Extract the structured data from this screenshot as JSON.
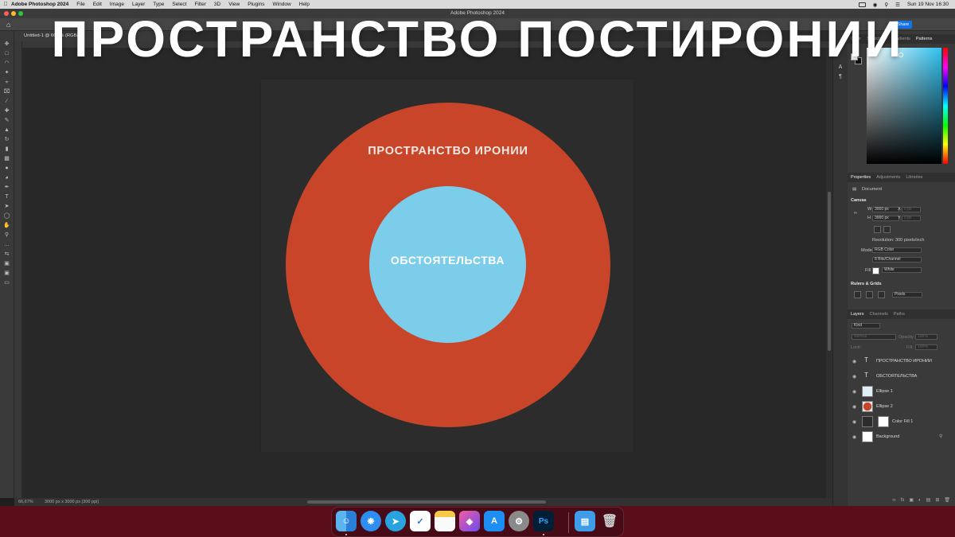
{
  "overlay_title": "ПРОСТРАНСТВО ПОСТИРОНИИ",
  "menubar": {
    "app_name": "Adobe Photoshop 2024",
    "items": [
      "File",
      "Edit",
      "Image",
      "Layer",
      "Type",
      "Select",
      "Filter",
      "3D",
      "View",
      "Plugins",
      "Window",
      "Help"
    ],
    "clock": "Sun 19 Nov  16:30"
  },
  "window": {
    "title": "Adobe Photoshop 2024",
    "share_label": "Share"
  },
  "document": {
    "tab_label": "Untitled-1 @ 66,7% (RGB/8/)"
  },
  "canvas": {
    "outer_label": "ПРОСТРАНСТВО ИРОНИИ",
    "inner_label": "ОБСТОЯТЕЛЬСТВА",
    "outer_color": "#c8452a",
    "inner_color": "#7bcdea",
    "background_color": "#2c2c2c"
  },
  "statusbar": {
    "zoom": "66,67%",
    "doc_info": "3000 px x 3000 px (300 ppi)"
  },
  "color_panel": {
    "tabs": [
      "Color",
      "Swatches",
      "Gradients",
      "Patterns"
    ]
  },
  "properties": {
    "tabs": [
      "Properties",
      "Adjustments",
      "Libraries"
    ],
    "doc_label": "Document",
    "canvas_header": "Canvas",
    "w_label": "W",
    "w_value": "3000 px",
    "h_label": "H",
    "h_value": "3000 px",
    "x_label": "X",
    "x_value": "0 px",
    "y_label": "Y",
    "y_value": "0 px",
    "resolution": "Resolution: 300 pixels/inch",
    "mode_label": "Mode",
    "mode_value": "RGB Color",
    "bits_value": "8 Bits/Channel",
    "fill_label": "Fill",
    "fill_value": "White",
    "rulers_header": "Rulers & Grids",
    "units_value": "Pixels"
  },
  "layers_panel": {
    "tabs": [
      "Layers",
      "Channels",
      "Paths"
    ],
    "kind_value": "Kind",
    "blend_value": "Normal",
    "opacity_label": "Opacity:",
    "opacity_value": "100%",
    "lock_label": "Lock:",
    "fill_label": "Fill:",
    "fill_value": "100%",
    "layers": [
      {
        "name": "ПРОСТРАНСТВО ИРОНИИ",
        "kind": "text"
      },
      {
        "name": "ОБСТОЯТЕЛЬСТВА",
        "kind": "text"
      },
      {
        "name": "Ellipse 1",
        "kind": "shape"
      },
      {
        "name": "Ellipse 2",
        "kind": "shape"
      },
      {
        "name": "Color Fill 1",
        "kind": "fill"
      },
      {
        "name": "Background",
        "kind": "background"
      }
    ]
  },
  "dock": {
    "apps": [
      "Finder",
      "Safari",
      "Telegram",
      "Reminders",
      "Notes",
      "Keynote",
      "App Store",
      "System Settings",
      "Photoshop",
      "Downloads",
      "Trash"
    ],
    "ps_label": "Ps"
  }
}
